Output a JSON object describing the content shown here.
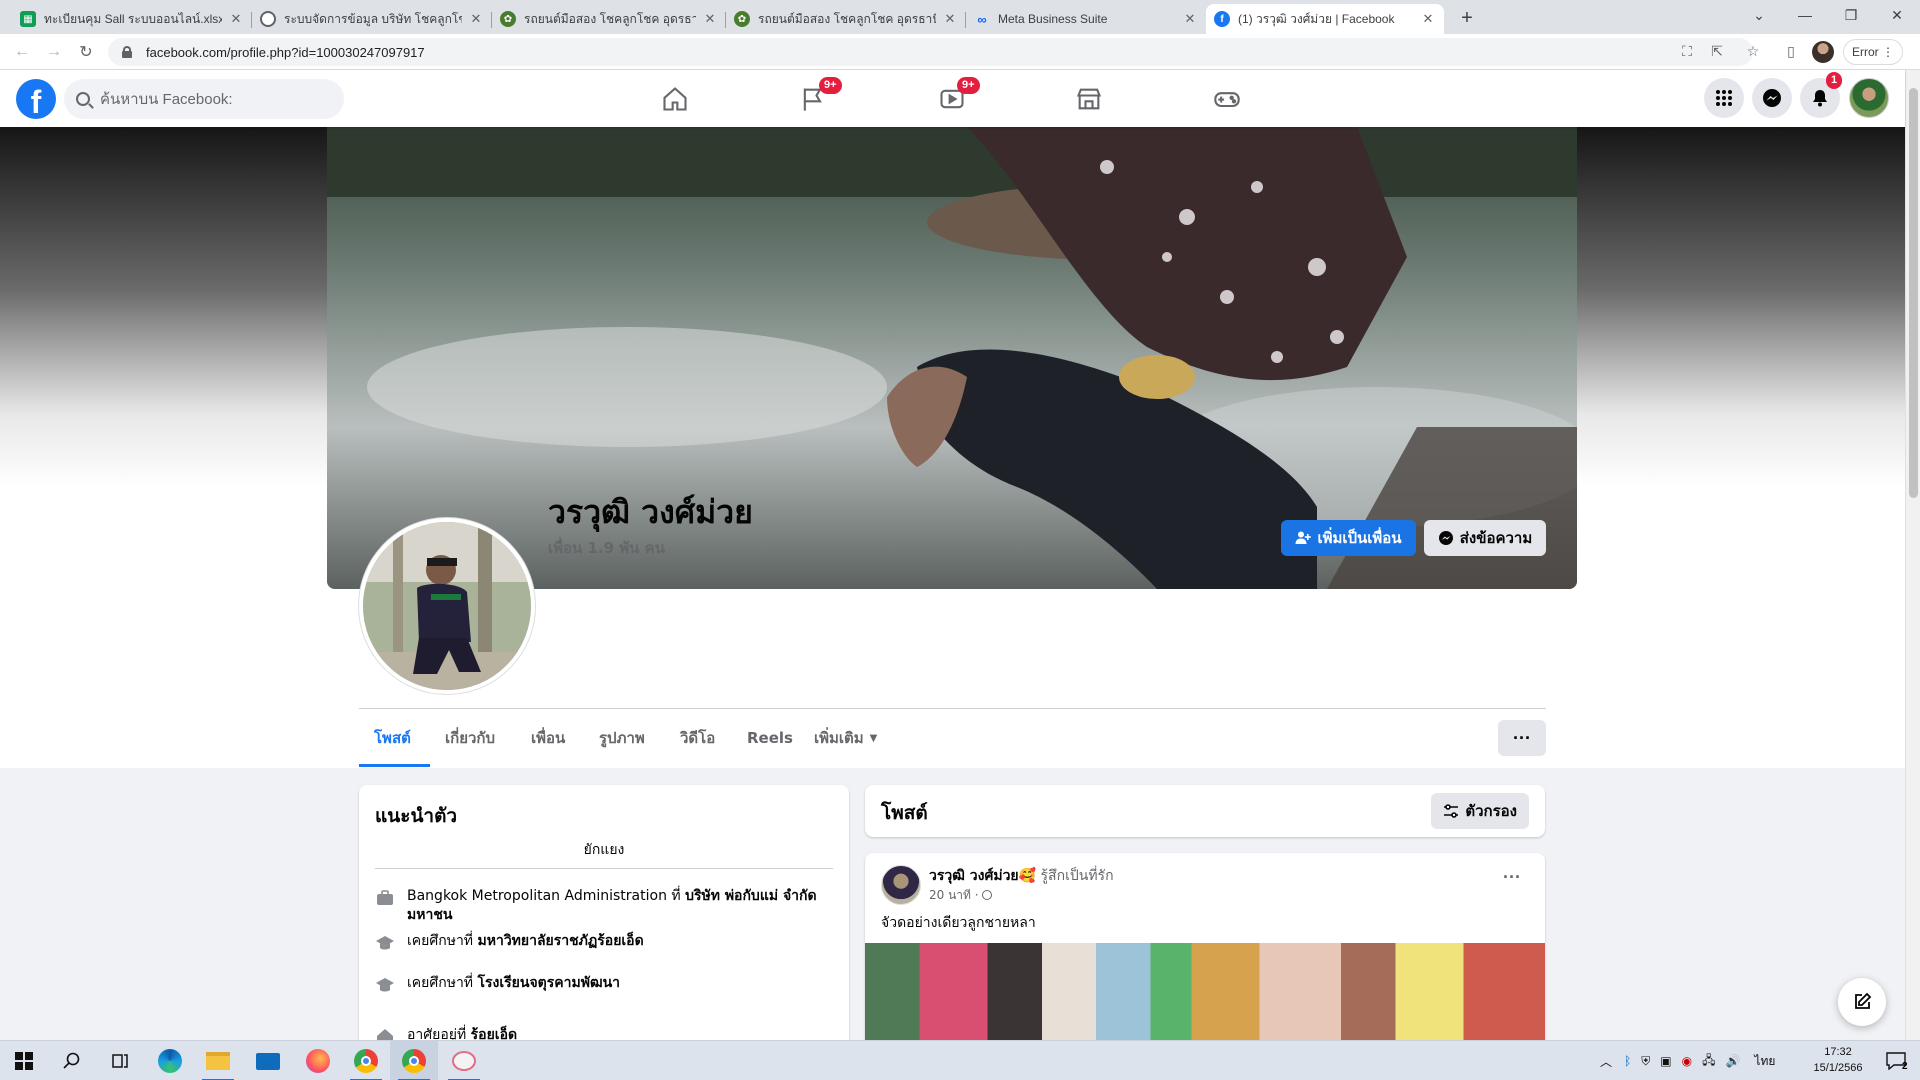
{
  "browser": {
    "tabs": [
      {
        "title": "ทะเบียนคุม Sall ระบบออนไลน์.xlsx - Go",
        "favicon_color": "#0f9d58",
        "favicon": "sheets-icon"
      },
      {
        "title": "ระบบจัดการข้อมูล บริษัท โชคลูกโชค อ",
        "favicon_color": "#5f6368",
        "favicon": "globe-icon"
      },
      {
        "title": "รถยนต์มือสอง โชคลูกโชค อุดรธานี",
        "favicon_color": "#4a7c2e",
        "favicon": "leaf-icon"
      },
      {
        "title": "รถยนต์มือสอง โชคลูกโชค อุดรธานี",
        "favicon_color": "#4a7c2e",
        "favicon": "leaf-icon"
      },
      {
        "title": "Meta Business Suite",
        "favicon_color": "#0866ff",
        "favicon": "meta-icon"
      },
      {
        "title": "(1) วรวุฒิ วงศ์ม่วย | Facebook",
        "favicon_color": "#1877f2",
        "favicon": "facebook-icon"
      }
    ],
    "url": "facebook.com/profile.php?id=100030247097917",
    "error_label": "Error"
  },
  "facebook": {
    "logo": "f",
    "search_placeholder": "ค้นหาบน Facebook:",
    "badges": {
      "pages": "9+",
      "watch": "9+",
      "notifications": "1"
    },
    "accent_color": "#1877f2"
  },
  "profile": {
    "name": "วรวุฒิ วงศ์ม่วย",
    "friends": "เพื่อน 1.9 พัน คน",
    "add_friend_label": "เพิ่มเป็นเพื่อน",
    "message_label": "ส่งข้อความ",
    "tabs": [
      "โพสต์",
      "เกี่ยวกับ",
      "เพื่อน",
      "รูปภาพ",
      "วิดีโอ",
      "Reels",
      "เพิ่มเติม"
    ],
    "more_menu": "···"
  },
  "intro": {
    "title": "แนะนำตัว",
    "bio": "ยักแยง",
    "rows": [
      {
        "prefix": "Bangkok Metropolitan Administration ที่ ",
        "bold": "บริษัท พ่อกับแม่ จำกัด มหาชน",
        "icon": "briefcase-icon"
      },
      {
        "prefix": "เคยศึกษาที่ ",
        "bold": "มหาวิทยาลัยราชภัฏร้อยเอ็ด",
        "icon": "graduation-cap-icon"
      },
      {
        "prefix": "เคยศึกษาที่ ",
        "bold": "โรงเรียนจตุรคามพัฒนา",
        "icon": "graduation-cap-icon"
      },
      {
        "prefix": "อาศัยอยู่ที่ ",
        "bold": "ร้อยเอ็ด",
        "icon": "home-icon"
      }
    ]
  },
  "posts": {
    "title": "โพสต์",
    "filter_label": "ตัวกรอง",
    "items": [
      {
        "author": "วรวุฒิ วงศ์ม่วย",
        "feeling": "รู้สึกเป็นที่รัก",
        "emoji": "🥰",
        "time": "20 นาที ·",
        "text": "จัวดอย่างเดียวลูกชายหลา"
      }
    ]
  },
  "taskbar": {
    "clock_time": "17:32",
    "clock_date": "15/1/2566",
    "language": "ไทย",
    "notification_count": "2"
  }
}
